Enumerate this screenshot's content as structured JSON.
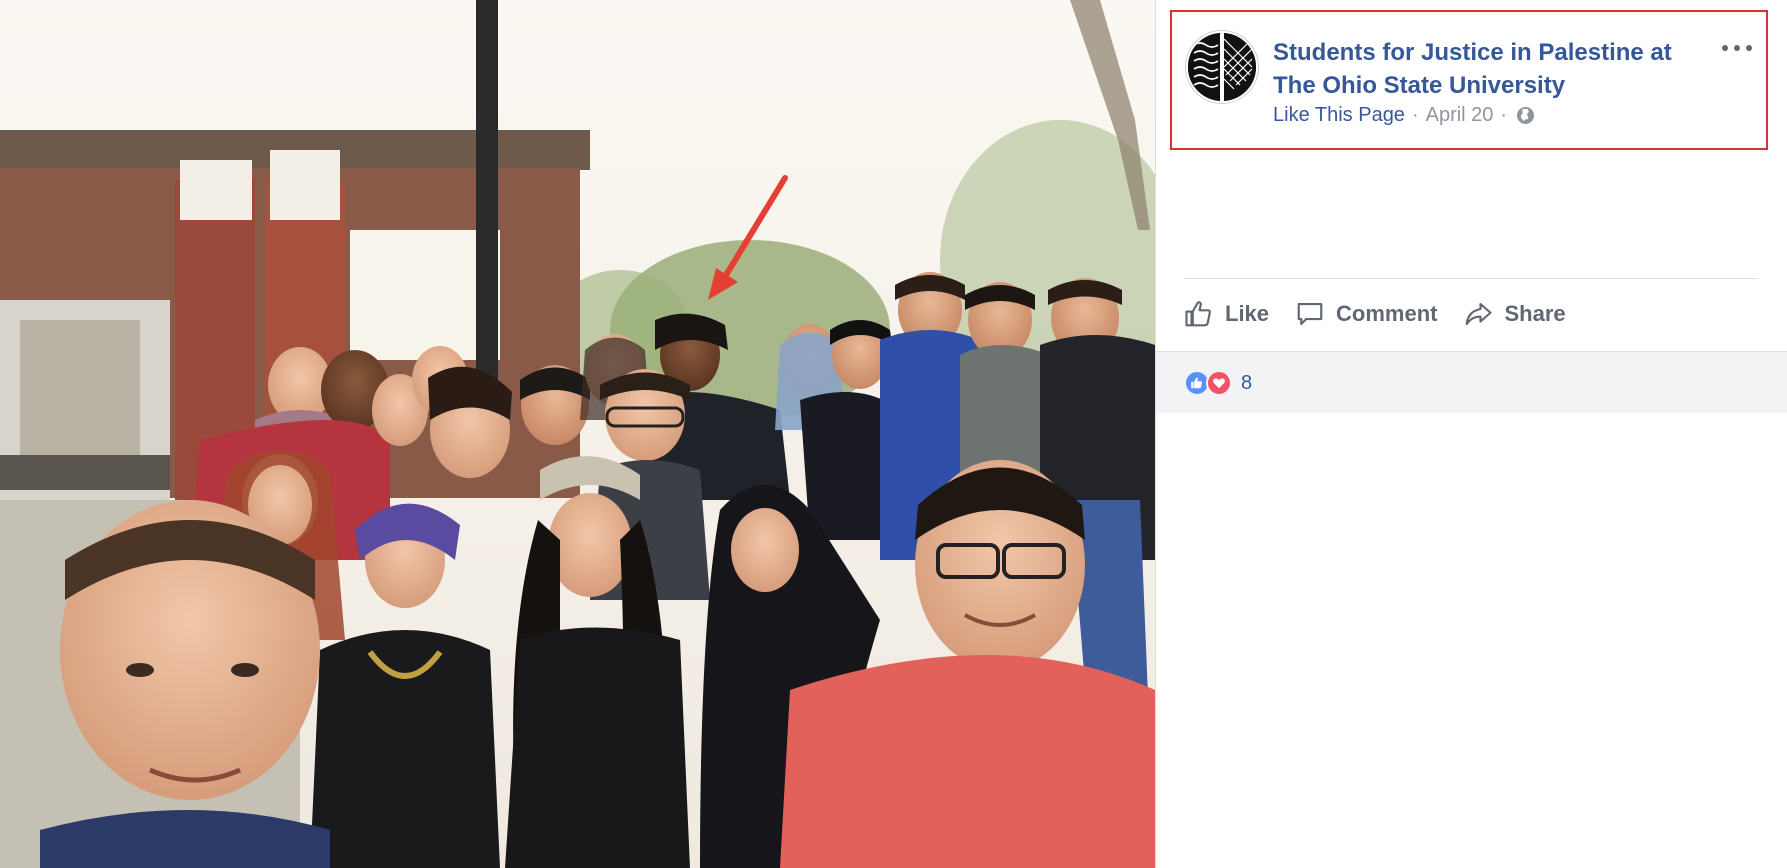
{
  "post": {
    "page_name": "Students for Justice in Palestine at The Ohio State University",
    "like_page_label": "Like This Page",
    "separator": "·",
    "date": "April 20",
    "privacy_icon": "globe-icon",
    "more_icon": "more-options-icon"
  },
  "actions": {
    "like_label": "Like",
    "comment_label": "Comment",
    "share_label": "Share"
  },
  "reactions": {
    "icons": [
      "like-reaction-icon",
      "love-reaction-icon"
    ],
    "count": "8"
  },
  "colors": {
    "link_blue": "#365899",
    "highlight_red": "#e0312f",
    "action_gray": "#606770",
    "like_blue": "#5890ff",
    "love_red": "#f25268"
  }
}
